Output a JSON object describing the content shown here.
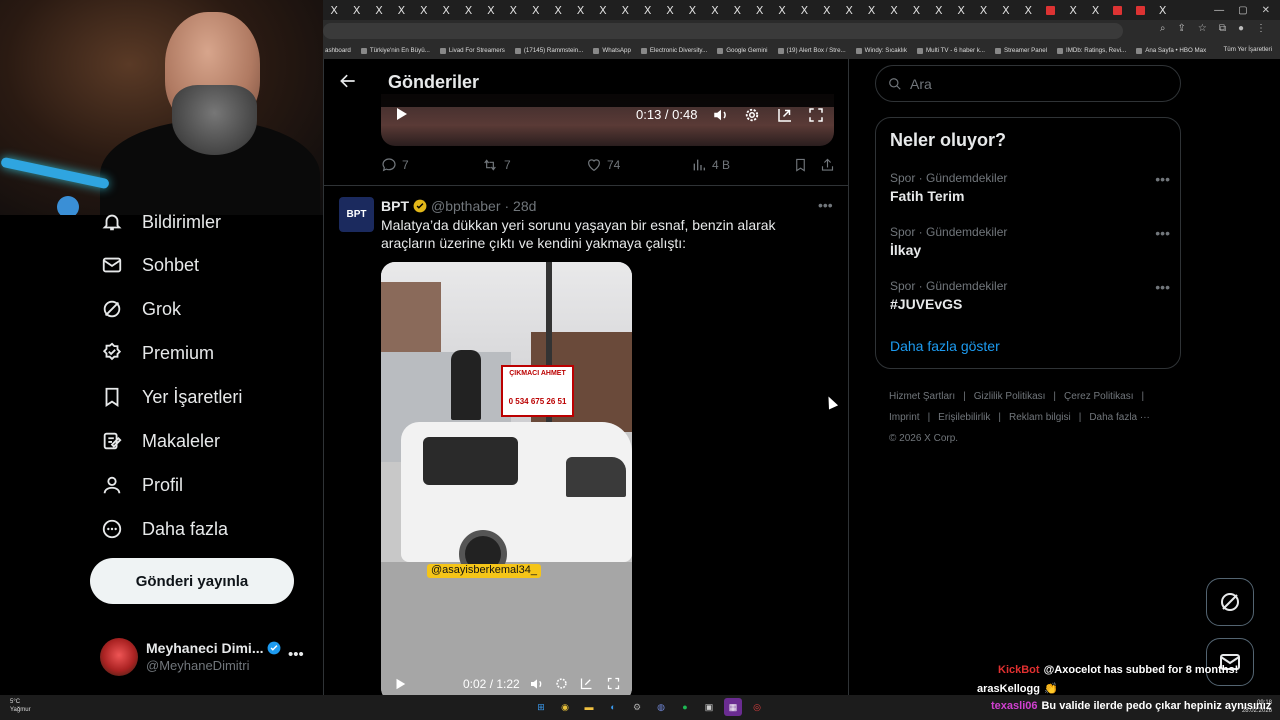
{
  "browser": {
    "tab_glyph": "X",
    "bookmarks": [
      "ashboard",
      "Türkiye'nin En Büyü...",
      "Livad For Streamers",
      "(17145) Rammstein...",
      "WhatsApp",
      "Electronic Diversity...",
      "Google Gemini",
      "(19) Alert Box / Stre...",
      "Windy: Sıcaklık",
      "Multi TV - 6 haber k...",
      "Streamer Panel",
      "IMDb: Ratings, Revi...",
      "Ana Sayfa • HBO Max"
    ],
    "all_bookmarks": "Tüm Yer İşaretleri"
  },
  "nav": {
    "items": [
      {
        "label": "Bildirimler",
        "icon": "bell-icon"
      },
      {
        "label": "Sohbet",
        "icon": "mail-icon"
      },
      {
        "label": "Grok",
        "icon": "grok-icon"
      },
      {
        "label": "Premium",
        "icon": "verified-icon"
      },
      {
        "label": "Yer İşaretleri",
        "icon": "bookmark-icon"
      },
      {
        "label": "Makaleler",
        "icon": "article-icon"
      },
      {
        "label": "Profil",
        "icon": "person-icon"
      },
      {
        "label": "Daha fazla",
        "icon": "more-circle-icon"
      }
    ],
    "post_button": "Gönderi yayınla",
    "profile": {
      "name": "Meyhaneci Dimi...",
      "handle": "@MeyhaneDimitri",
      "more": "•••"
    }
  },
  "main": {
    "title": "Gönderiler",
    "tweet1": {
      "video_time": "0:13 / 0:48",
      "replies": "7",
      "reposts": "7",
      "likes": "74",
      "views": "4 B"
    },
    "tweet2": {
      "avatar_text": "BPT",
      "name": "BPT",
      "handle": "@bpthaber",
      "age": "· 28d",
      "text": "Malatya’da dükkan yeri sorunu yaşayan bir esnaf, benzin alarak araçların üzerine çıktı ve kendini yakmaya çalıştı:",
      "video_time": "0:02 / 1:22",
      "sign_text": "ÇIKMACI AHMET",
      "sign_phone": "0 534 675 26 51",
      "watermark": "@asayisberkemal34_"
    }
  },
  "sidebar": {
    "search_placeholder": "Ara",
    "trends_title": "Neler oluyor?",
    "trends": [
      {
        "category": "Spor · Gündemdekiler",
        "name": "Fatih Terim"
      },
      {
        "category": "Spor · Gündemdekiler",
        "name": "İlkay"
      },
      {
        "category": "Spor · Gündemdekiler",
        "name": "#JUVEvGS"
      }
    ],
    "show_more": "Daha fazla göster",
    "footer": {
      "links1": [
        "Hizmet Şartları",
        "Gizlilik Politikası",
        "Çerez Politikası"
      ],
      "links2": [
        "Imprint",
        "Erişilebilirlik",
        "Reklam bilgisi",
        "Daha fazla ···"
      ],
      "copyright": "© 2026 X Corp."
    }
  },
  "chat": [
    {
      "user": "KickBot",
      "user_color": "#e03030",
      "message": "@Axocelot has subbed for 8 months!"
    },
    {
      "user": "arasKellogg",
      "user_color": "#ffffff",
      "message": "👏"
    },
    {
      "user": "texasli06",
      "user_color": "#d040d0",
      "message": "Bu valide ilerde pedo çıkar hepiniz aynısınız"
    }
  ],
  "taskbar": {
    "weather_temp": "5°C",
    "weather_desc": "Yağmur",
    "time": "09:18",
    "date": "28.02.2026"
  }
}
